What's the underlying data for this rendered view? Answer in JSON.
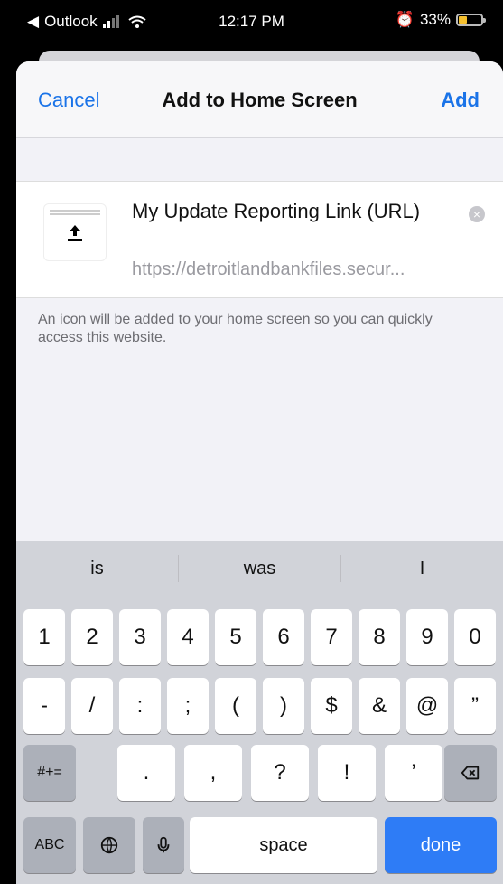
{
  "status": {
    "back_app": "Outlook",
    "time": "12:17 PM",
    "battery": "33%",
    "battery_level": 0.33
  },
  "nav": {
    "cancel": "Cancel",
    "title": "Add to Home Screen",
    "add": "Add"
  },
  "form": {
    "name_value": "My Update Reporting Link (URL)",
    "url": "https://detroitlandbankfiles.secur..."
  },
  "info": "An icon will be added to your home screen so you can quickly access this website.",
  "keyboard": {
    "suggestions": [
      "is",
      "was",
      "I"
    ],
    "row1": [
      "1",
      "2",
      "3",
      "4",
      "5",
      "6",
      "7",
      "8",
      "9",
      "0"
    ],
    "row2": [
      "-",
      "/",
      ":",
      ";",
      "(",
      ")",
      "$",
      "&",
      "@",
      "”"
    ],
    "row3": {
      "symbols": "#+=",
      "keys": [
        ".",
        ",",
        "?",
        "!",
        "’"
      ]
    },
    "row4": {
      "abc": "ABC",
      "space": "space",
      "done": "done"
    }
  },
  "icons": {
    "back": "back-triangle-icon",
    "signal": "cellular-signal-icon",
    "wifi": "wifi-icon",
    "alarm": "alarm-icon",
    "battery": "battery-icon",
    "clear": "clear-circle-icon",
    "upload": "upload-icon",
    "globe": "globe-icon",
    "mic": "microphone-icon",
    "delete": "delete-backspace-icon"
  }
}
